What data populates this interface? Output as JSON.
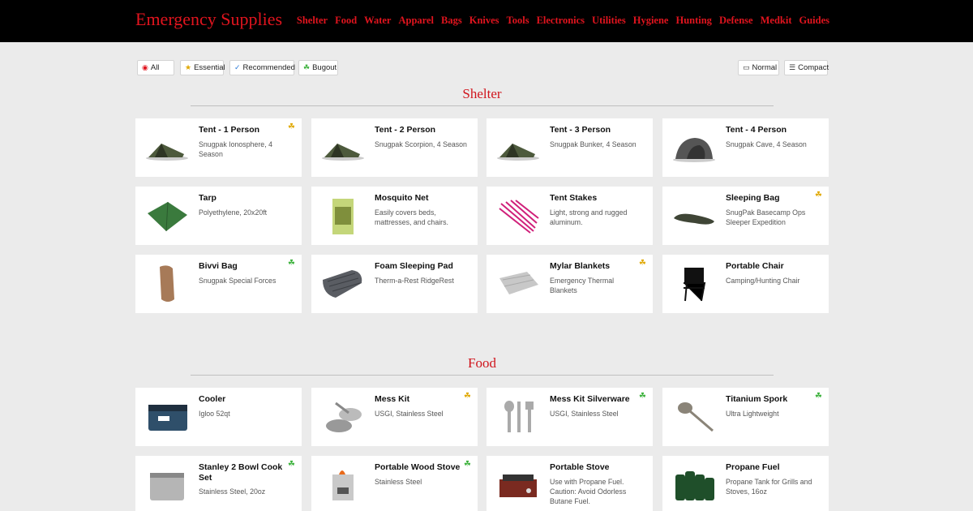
{
  "header": {
    "brand": "Emergency Supplies",
    "nav": [
      "Shelter",
      "Food",
      "Water",
      "Apparel",
      "Bags",
      "Knives",
      "Tools",
      "Electronics",
      "Utilities",
      "Hygiene",
      "Hunting",
      "Defense",
      "Medkit",
      "Guides"
    ]
  },
  "filters": {
    "left": [
      {
        "label": "All",
        "icon": "radio-selected-icon",
        "glyph": "◉",
        "color": "#e0141e"
      },
      {
        "label": "Essential",
        "icon": "star-icon",
        "glyph": "★",
        "color": "#e0a800"
      },
      {
        "label": "Recommended",
        "icon": "check-icon",
        "glyph": "✓",
        "color": "#2a7ad8"
      },
      {
        "label": "Bugout",
        "icon": "clover-icon",
        "glyph": "☘",
        "color": "#3bb13b"
      }
    ],
    "right": [
      {
        "label": "Normal",
        "icon": "window-icon",
        "glyph": "▭"
      },
      {
        "label": "Compact",
        "icon": "list-icon",
        "glyph": "☰"
      }
    ]
  },
  "sections": [
    {
      "title": "Shelter",
      "items": [
        {
          "title": "Tent - 1 Person",
          "desc": "Snugpak Ionosphere, 4 Season",
          "badge": "gold",
          "img": "tent"
        },
        {
          "title": "Tent - 2 Person",
          "desc": "Snugpak Scorpion, 4 Season",
          "badge": "",
          "img": "tent"
        },
        {
          "title": "Tent - 3 Person",
          "desc": "Snugpak Bunker, 4 Season",
          "badge": "",
          "img": "tent"
        },
        {
          "title": "Tent - 4 Person",
          "desc": "Snugpak Cave, 4 Season",
          "badge": "",
          "img": "dome"
        },
        {
          "title": "Tarp",
          "desc": "Polyethylene, 20x20ft",
          "badge": "",
          "img": "tarp"
        },
        {
          "title": "Mosquito Net",
          "desc": "Easily covers beds, mattresses, and chairs.",
          "badge": "",
          "img": "net"
        },
        {
          "title": "Tent Stakes",
          "desc": "Light, strong and rugged aluminum.",
          "badge": "",
          "img": "stakes"
        },
        {
          "title": "Sleeping Bag",
          "desc": "SnugPak Basecamp Ops Sleeper Expedition",
          "badge": "gold",
          "img": "bag"
        },
        {
          "title": "Bivvi Bag",
          "desc": "Snugpak Special Forces",
          "badge": "green",
          "img": "bivvi"
        },
        {
          "title": "Foam Sleeping Pad",
          "desc": "Therm-a-Rest RidgeRest",
          "badge": "",
          "img": "pad"
        },
        {
          "title": "Mylar Blankets",
          "desc": "Emergency Thermal Blankets",
          "badge": "gold",
          "img": "mylar"
        },
        {
          "title": "Portable Chair",
          "desc": "Camping/Hunting Chair",
          "badge": "",
          "img": "chair"
        }
      ]
    },
    {
      "title": "Food",
      "items": [
        {
          "title": "Cooler",
          "desc": "Igloo 52qt",
          "badge": "",
          "img": "cooler"
        },
        {
          "title": "Mess Kit",
          "desc": "USGI, Stainless Steel",
          "badge": "gold",
          "img": "mess"
        },
        {
          "title": "Mess Kit Silverware",
          "desc": "USGI, Stainless Steel",
          "badge": "green",
          "img": "silver"
        },
        {
          "title": "Titanium Spork",
          "desc": "Ultra Lightweight",
          "badge": "green",
          "img": "spork"
        },
        {
          "title": "Stanley 2 Bowl Cook Set",
          "desc": "Stainless Steel, 20oz",
          "badge": "green",
          "img": "pot"
        },
        {
          "title": "Portable Wood Stove",
          "desc": "Stainless Steel",
          "badge": "green",
          "img": "woodstove"
        },
        {
          "title": "Portable Stove",
          "desc": "Use with Propane Fuel. Caution: Avoid Odorless Butane Fuel.",
          "badge": "",
          "img": "stove"
        },
        {
          "title": "Propane Fuel",
          "desc": "Propane Tank for Grills and Stoves, 16oz",
          "badge": "",
          "img": "propane"
        }
      ]
    }
  ]
}
